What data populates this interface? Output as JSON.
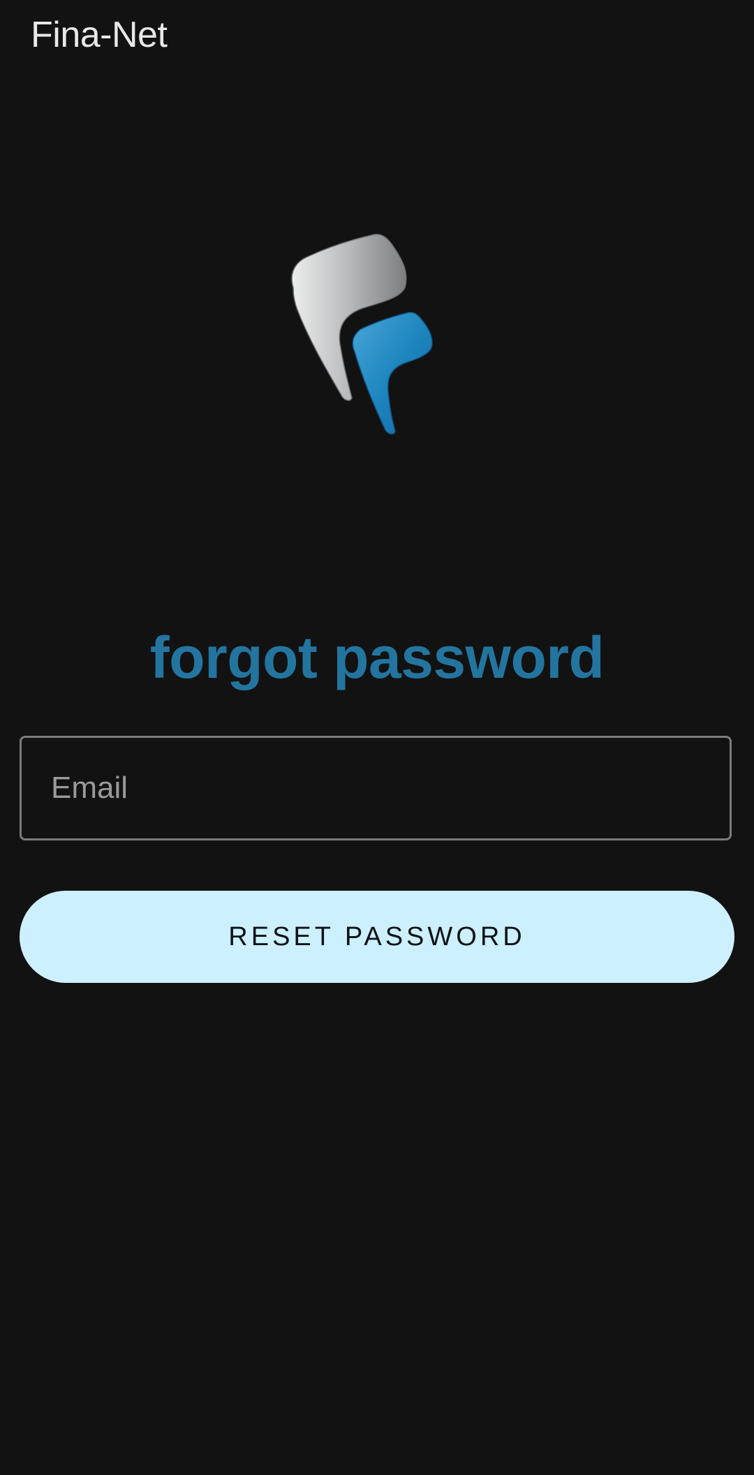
{
  "app": {
    "title": "Fina-Net"
  },
  "logo": {
    "icon": "fina-net-logo",
    "colors": {
      "silver": "#c9cacc",
      "blue": "#1e86bf"
    }
  },
  "page": {
    "heading": "forgot password"
  },
  "form": {
    "email_placeholder": "Email",
    "email_value": "",
    "reset_label": "RESET PASSWORD"
  },
  "theme": {
    "background": "#121212",
    "accent": "#23759f",
    "button_bg": "#cdf0ff",
    "field_border": "#7c7c7c"
  }
}
